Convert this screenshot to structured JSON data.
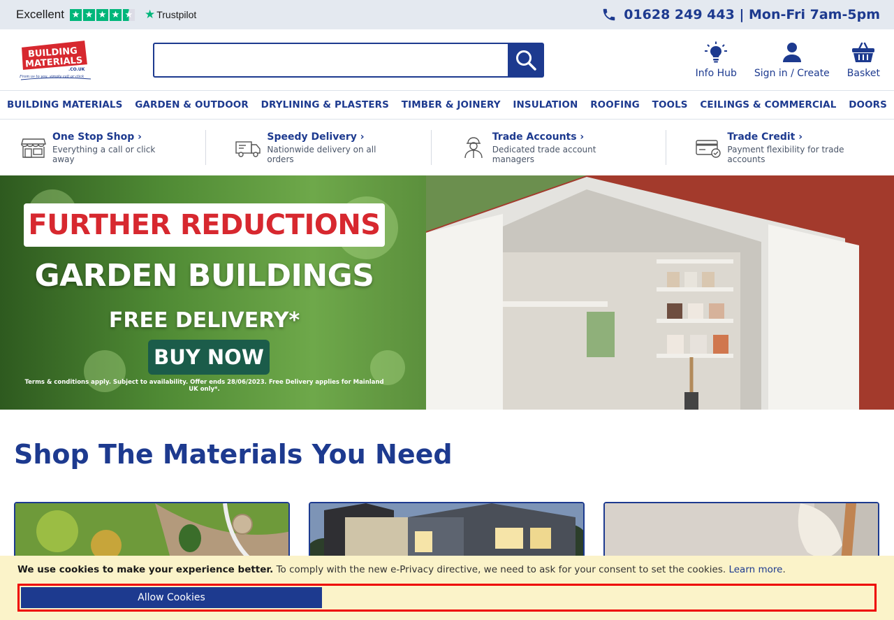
{
  "topbar": {
    "rating_label": "Excellent",
    "trustpilot_label": "Trustpilot",
    "phone": "01628 249 443 | Mon-Fri 7am-5pm"
  },
  "header": {
    "logo_text_line1": "BUILDING",
    "logo_text_line2": "MATERIALS",
    "logo_tld": ".CO.UK",
    "logo_tagline": "From us to you, simply call or click",
    "search_value": "",
    "links": [
      {
        "label": "Info Hub",
        "icon": "lightbulb-icon"
      },
      {
        "label": "Sign in / Create",
        "icon": "user-icon"
      },
      {
        "label": "Basket",
        "icon": "basket-icon"
      }
    ]
  },
  "nav": {
    "items": [
      "BUILDING MATERIALS",
      "GARDEN & OUTDOOR",
      "DRYLINING & PLASTERS",
      "TIMBER & JOINERY",
      "INSULATION",
      "ROOFING",
      "TOOLS",
      "CEILINGS & COMMERCIAL",
      "DOORS"
    ]
  },
  "usps": [
    {
      "title": "One Stop Shop",
      "subtitle": "Everything a call or click away",
      "icon": "shop-icon"
    },
    {
      "title": "Speedy Delivery",
      "subtitle": "Nationwide delivery on all orders",
      "icon": "truck-icon"
    },
    {
      "title": "Trade Accounts",
      "subtitle": "Dedicated trade account managers",
      "icon": "worker-icon"
    },
    {
      "title": "Trade Credit",
      "subtitle": "Payment flexibility for trade accounts",
      "icon": "credit-card-icon"
    }
  ],
  "hero": {
    "banner_title": "FURTHER REDUCTIONS",
    "line1": "GARDEN BUILDINGS",
    "line2": "FREE DELIVERY*",
    "cta": "BUY NOW",
    "terms": "Terms & conditions apply. Subject to availability. Offer ends 28/06/2023. Free Delivery applies for Mainland UK only*."
  },
  "section": {
    "title": "Shop The Materials You Need"
  },
  "cookie": {
    "bold_text": "We use cookies to make your experience better.",
    "text": " To comply with the new e-Privacy directive, we need to ask for your consent to set the cookies. ",
    "link": "Learn more",
    "period": ".",
    "button": "Allow Cookies"
  },
  "colors": {
    "brand_blue": "#1d3a8f",
    "brand_red": "#d7282f",
    "trustpilot_green": "#00b67a",
    "cookie_bg": "#fbf3c9"
  }
}
